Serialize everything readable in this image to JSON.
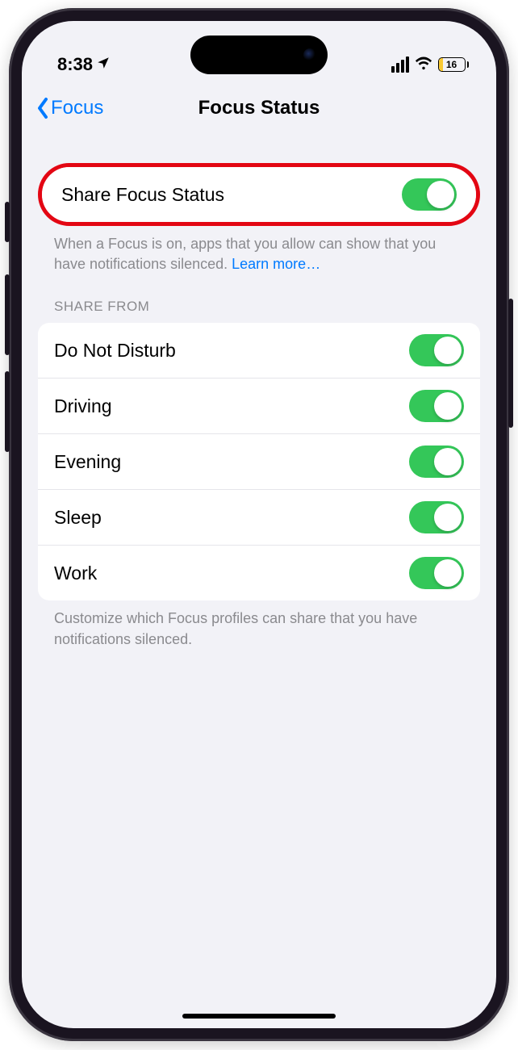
{
  "status_bar": {
    "time": "8:38",
    "battery_percent": "16"
  },
  "nav": {
    "back_label": "Focus",
    "title": "Focus Status"
  },
  "share_status": {
    "label": "Share Focus Status",
    "description": "When a Focus is on, apps that you allow can show that you have notifications silenced. ",
    "learn_more": "Learn more…"
  },
  "share_from": {
    "header": "SHARE FROM",
    "items": [
      {
        "label": "Do Not Disturb"
      },
      {
        "label": "Driving"
      },
      {
        "label": "Evening"
      },
      {
        "label": "Sleep"
      },
      {
        "label": "Work"
      }
    ],
    "footer": "Customize which Focus profiles can share that you have notifications silenced."
  }
}
